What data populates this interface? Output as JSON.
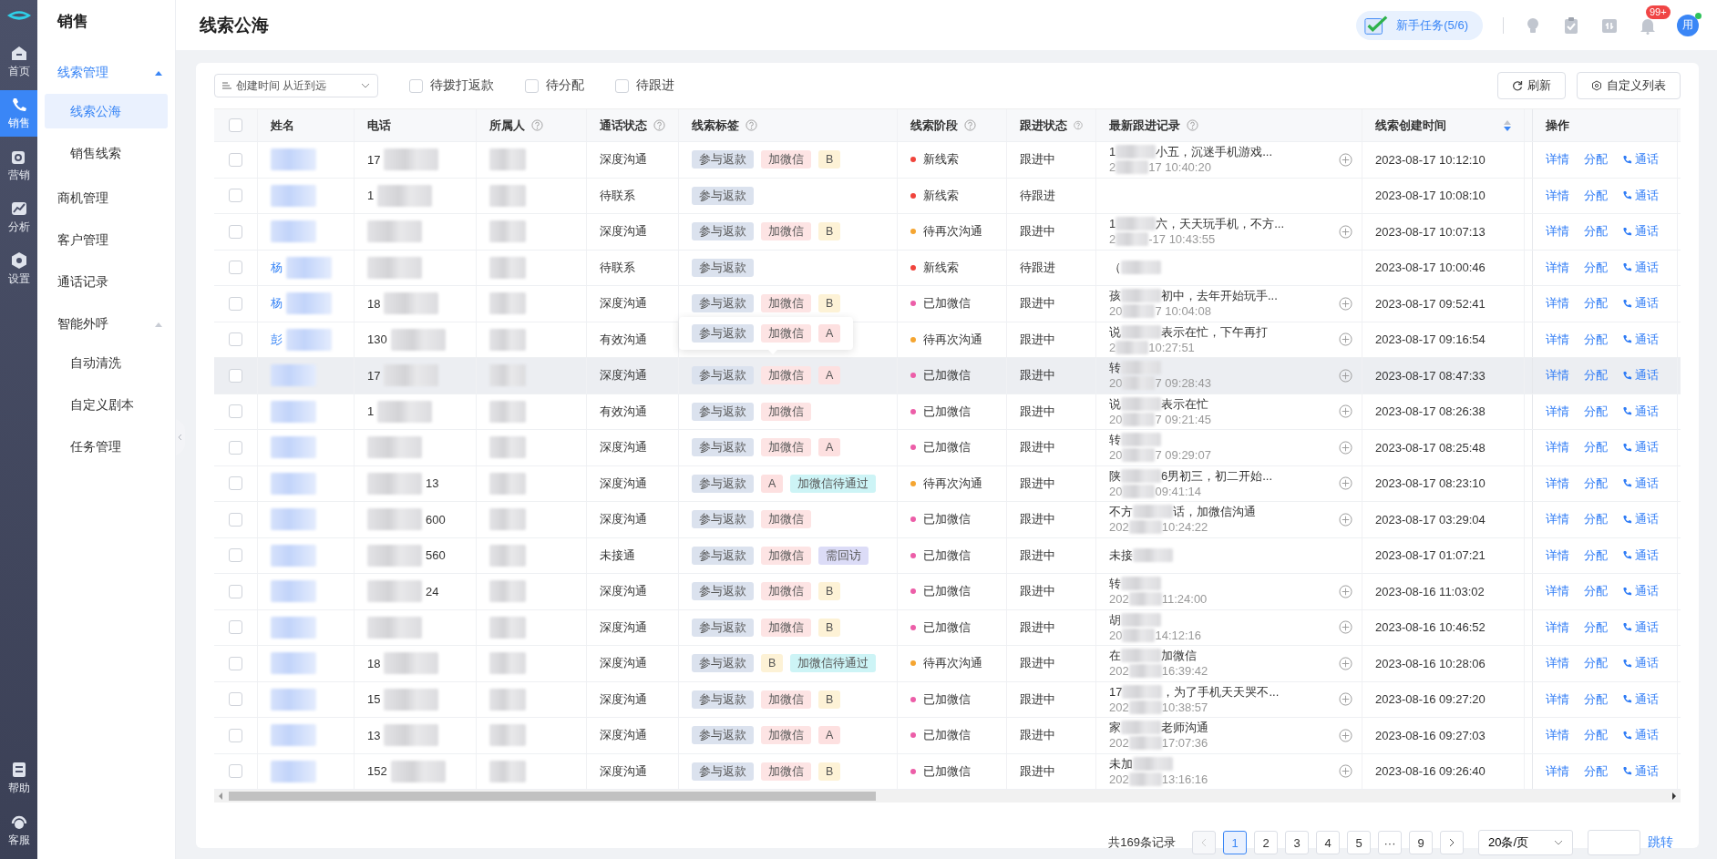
{
  "rail": [
    {
      "label": "首页",
      "selected": false
    },
    {
      "label": "销售",
      "selected": true
    },
    {
      "label": "营销",
      "selected": false
    },
    {
      "label": "分析",
      "selected": false
    },
    {
      "label": "设置",
      "selected": false
    }
  ],
  "rail_bottom": [
    {
      "label": "帮助"
    },
    {
      "label": "客服"
    }
  ],
  "menu": {
    "title": "销售",
    "groups": [
      {
        "label": "线索管理",
        "active": true,
        "expanded": true,
        "children": [
          {
            "label": "线索公海",
            "selected": true
          },
          {
            "label": "销售线索",
            "selected": false
          }
        ]
      },
      {
        "label": "商机管理",
        "active": false
      },
      {
        "label": "客户管理",
        "active": false
      },
      {
        "label": "通话记录",
        "active": false
      },
      {
        "label": "智能外呼",
        "active": false,
        "expanded": true,
        "children": [
          {
            "label": "自动清洗",
            "selected": false
          },
          {
            "label": "自定义剧本",
            "selected": false
          },
          {
            "label": "任务管理",
            "selected": false
          }
        ]
      }
    ]
  },
  "page_title": "线索公海",
  "task_button": "新手任务(5/6)",
  "notification_badge": "99+",
  "avatar": "用",
  "toolbar": {
    "sort": "创建时间 从近到远",
    "filters": [
      {
        "label": "待拨打返款",
        "checked": false
      },
      {
        "label": "待分配",
        "checked": false
      },
      {
        "label": "待跟进",
        "checked": false
      }
    ],
    "buttons": [
      "刷新",
      "自定义列表"
    ]
  },
  "table": {
    "header_checked": false,
    "columns": [
      {
        "label": "姓名",
        "help": false
      },
      {
        "label": "电话",
        "help": false
      },
      {
        "label": "所属人",
        "help": true
      },
      {
        "label": "通话状态",
        "help": true
      },
      {
        "label": "线索标签",
        "help": true
      },
      {
        "label": "线索阶段",
        "help": true
      },
      {
        "label": "跟进状态",
        "help": true
      },
      {
        "label": "最新跟进记录",
        "help": true
      },
      {
        "label": "线索创建时间",
        "help": false,
        "sortable": true
      },
      {
        "label": "操作",
        "help": false
      }
    ],
    "rows": [
      {
        "checked": false,
        "hovered": false,
        "phone": "17",
        "call_status": "深度沟通",
        "tags": [
          {
            "text": "参与返款",
            "color": "#dbe2ee"
          },
          {
            "text": "加微信",
            "color": "#fde4e4"
          },
          {
            "text": "B",
            "color": "#fdf2d6"
          }
        ],
        "stage": {
          "text": "新线索",
          "color": "#f0443c"
        },
        "follow": "跟进中",
        "note": {
          "head": "1",
          "tail": "小五，沉迷手机游戏...",
          "time_head": "2",
          "time_tail": "17 10:40:20"
        },
        "created": "2023-08-17 10:12:10",
        "actions": [
          "详情",
          "分配",
          "通话"
        ]
      },
      {
        "checked": false,
        "hovered": false,
        "phone": "1",
        "call_status": "待联系",
        "tags": [
          {
            "text": "参与返款",
            "color": "#dbe2ee"
          }
        ],
        "stage": {
          "text": "新线索",
          "color": "#f0443c"
        },
        "follow": "待跟进",
        "created": "2023-08-17 10:08:10",
        "actions": [
          "详情",
          "分配",
          "通话"
        ]
      },
      {
        "checked": false,
        "hovered": false,
        "call_status": "深度沟通",
        "tags": [
          {
            "text": "参与返款",
            "color": "#dbe2ee"
          },
          {
            "text": "加微信",
            "color": "#fde4e4"
          },
          {
            "text": "B",
            "color": "#fdf2d6"
          }
        ],
        "stage": {
          "text": "待再次沟通",
          "color": "#f5a531"
        },
        "follow": "跟进中",
        "note": {
          "head": "1",
          "tail": "六，天天玩手机，不方...",
          "time_head": "2",
          "time_tail": "-17 10:43:55"
        },
        "created": "2023-08-17 10:07:13",
        "actions": [
          "详情",
          "分配",
          "通话"
        ]
      },
      {
        "checked": false,
        "hovered": false,
        "name": "杨",
        "call_status": "待联系",
        "tags": [
          {
            "text": "参与返款",
            "color": "#dbe2ee"
          }
        ],
        "stage": {
          "text": "新线索",
          "color": "#f0443c"
        },
        "follow": "待跟进",
        "note": {
          "head": "（"
        },
        "created": "2023-08-17 10:00:46",
        "actions": [
          "详情",
          "分配",
          "通话"
        ]
      },
      {
        "checked": false,
        "hovered": false,
        "name": "杨",
        "phone": "18",
        "call_status": "深度沟通",
        "tags": [
          {
            "text": "参与返款",
            "color": "#dbe2ee"
          },
          {
            "text": "加微信",
            "color": "#fde4e4"
          },
          {
            "text": "B",
            "color": "#fdf2d6"
          }
        ],
        "stage": {
          "text": "已加微信",
          "color": "#ec5ea8"
        },
        "follow": "跟进中",
        "note": {
          "head": "孩",
          "tail": "初中，去年开始玩手...",
          "time_head": "20",
          "time_tail": "7 10:04:08"
        },
        "created": "2023-08-17 09:52:41",
        "actions": [
          "详情",
          "分配",
          "通话"
        ]
      },
      {
        "checked": false,
        "hovered": false,
        "name": "彭",
        "phone": "130",
        "call_status": "有效沟通",
        "popover": [
          {
            "text": "参与返款",
            "color": "#dbe2ee"
          },
          {
            "text": "加微信",
            "color": "#fde4e4"
          },
          {
            "text": "A",
            "color": "#fde0e0"
          }
        ],
        "stage": {
          "text": "待再次沟通",
          "color": "#f5a531"
        },
        "follow": "跟进中",
        "note": {
          "head": "说",
          "tail": "表示在忙，下午再打",
          "time_head": "2",
          "time_tail": "10:27:51"
        },
        "created": "2023-08-17 09:16:54",
        "actions": [
          "详情",
          "分配",
          "通话"
        ]
      },
      {
        "checked": false,
        "hovered": true,
        "phone": "17",
        "call_status": "深度沟通",
        "tags": [
          {
            "text": "参与返款",
            "color": "#dbe2ee"
          },
          {
            "text": "加微信",
            "color": "#fde4e4"
          },
          {
            "text": "A",
            "color": "#fde0e0"
          }
        ],
        "stage": {
          "text": "已加微信",
          "color": "#ec5ea8"
        },
        "follow": "跟进中",
        "note": {
          "head": "转",
          "time_head": "20",
          "time_tail": "7 09:28:43"
        },
        "created": "2023-08-17 08:47:33",
        "actions": [
          "详情",
          "分配",
          "通话"
        ]
      },
      {
        "checked": false,
        "hovered": false,
        "phone": "1",
        "call_status": "有效沟通",
        "tags": [
          {
            "text": "参与返款",
            "color": "#dbe2ee"
          },
          {
            "text": "加微信",
            "color": "#fde4e4"
          }
        ],
        "stage": {
          "text": "已加微信",
          "color": "#ec5ea8"
        },
        "follow": "跟进中",
        "note": {
          "head": "说",
          "tail": "表示在忙",
          "time_head": "20",
          "time_tail": "7 09:21:45"
        },
        "created": "2023-08-17 08:26:38",
        "actions": [
          "详情",
          "分配",
          "通话"
        ]
      },
      {
        "checked": false,
        "hovered": false,
        "call_status": "深度沟通",
        "tags": [
          {
            "text": "参与返款",
            "color": "#dbe2ee"
          },
          {
            "text": "加微信",
            "color": "#fde4e4"
          },
          {
            "text": "A",
            "color": "#fde0e0"
          }
        ],
        "stage": {
          "text": "已加微信",
          "color": "#ec5ea8"
        },
        "follow": "跟进中",
        "note": {
          "head": "转",
          "time_head": "20",
          "time_tail": "7 09:29:07"
        },
        "created": "2023-08-17 08:25:48",
        "actions": [
          "详情",
          "分配",
          "通话"
        ]
      },
      {
        "checked": false,
        "hovered": false,
        "phone_tail": "13",
        "call_status": "深度沟通",
        "tags": [
          {
            "text": "参与返款",
            "color": "#dbe2ee"
          },
          {
            "text": "A",
            "color": "#fde0e0"
          },
          {
            "text": "加微信待通过",
            "color": "#cdf4f6"
          }
        ],
        "stage": {
          "text": "待再次沟通",
          "color": "#f5a531"
        },
        "follow": "跟进中",
        "note": {
          "head": "陕",
          "tail": "6男初三，初二开始...",
          "time_head": "20",
          "time_tail": "09:41:14"
        },
        "created": "2023-08-17 08:23:10",
        "actions": [
          "详情",
          "分配",
          "通话"
        ]
      },
      {
        "checked": false,
        "hovered": false,
        "phone_tail": "600",
        "call_status": "深度沟通",
        "tags": [
          {
            "text": "参与返款",
            "color": "#dbe2ee"
          },
          {
            "text": "加微信",
            "color": "#fde4e4"
          }
        ],
        "stage": {
          "text": "已加微信",
          "color": "#ec5ea8"
        },
        "follow": "跟进中",
        "note": {
          "head": "不方",
          "tail": "话，加微信沟通",
          "time_head": "202",
          "time_tail": "10:24:22"
        },
        "created": "2023-08-17 03:29:04",
        "actions": [
          "详情",
          "分配",
          "通话"
        ]
      },
      {
        "checked": false,
        "hovered": false,
        "phone_tail": "560",
        "call_status": "未接通",
        "tags": [
          {
            "text": "参与返款",
            "color": "#dbe2ee"
          },
          {
            "text": "加微信",
            "color": "#fde4e4"
          },
          {
            "text": "需回访",
            "color": "#dcdcf7"
          }
        ],
        "stage": {
          "text": "已加微信",
          "color": "#ec5ea8"
        },
        "follow": "跟进中",
        "note": {
          "head": "未接"
        },
        "created": "2023-08-17 01:07:21",
        "actions": [
          "详情",
          "分配",
          "通话"
        ]
      },
      {
        "checked": false,
        "hovered": false,
        "phone_tail": "24",
        "call_status": "深度沟通",
        "tags": [
          {
            "text": "参与返款",
            "color": "#dbe2ee"
          },
          {
            "text": "加微信",
            "color": "#fde4e4"
          },
          {
            "text": "B",
            "color": "#fdf2d6"
          }
        ],
        "stage": {
          "text": "已加微信",
          "color": "#ec5ea8"
        },
        "follow": "跟进中",
        "note": {
          "head": "转",
          "time_head": "202",
          "time_tail": "11:24:00"
        },
        "created": "2023-08-16 11:03:02",
        "actions": [
          "详情",
          "分配",
          "通话"
        ]
      },
      {
        "checked": false,
        "hovered": false,
        "call_status": "深度沟通",
        "tags": [
          {
            "text": "参与返款",
            "color": "#dbe2ee"
          },
          {
            "text": "加微信",
            "color": "#fde4e4"
          },
          {
            "text": "B",
            "color": "#fdf2d6"
          }
        ],
        "stage": {
          "text": "已加微信",
          "color": "#ec5ea8"
        },
        "follow": "跟进中",
        "note": {
          "head": "胡",
          "time_head": "20",
          "time_tail": "14:12:16"
        },
        "created": "2023-08-16 10:46:52",
        "actions": [
          "详情",
          "分配",
          "通话"
        ]
      },
      {
        "checked": false,
        "hovered": false,
        "phone": "18",
        "call_status": "深度沟通",
        "tags": [
          {
            "text": "参与返款",
            "color": "#dbe2ee"
          },
          {
            "text": "B",
            "color": "#fdf2d6"
          },
          {
            "text": "加微信待通过",
            "color": "#cdf4f6"
          }
        ],
        "stage": {
          "text": "待再次沟通",
          "color": "#f5a531"
        },
        "follow": "跟进中",
        "note": {
          "head": "在",
          "tail": "加微信",
          "time_head": "202",
          "time_tail": "16:39:42"
        },
        "created": "2023-08-16 10:28:06",
        "actions": [
          "详情",
          "分配",
          "通话"
        ]
      },
      {
        "checked": false,
        "hovered": false,
        "phone": "15",
        "call_status": "深度沟通",
        "tags": [
          {
            "text": "参与返款",
            "color": "#dbe2ee"
          },
          {
            "text": "加微信",
            "color": "#fde4e4"
          },
          {
            "text": "B",
            "color": "#fdf2d6"
          }
        ],
        "stage": {
          "text": "已加微信",
          "color": "#ec5ea8"
        },
        "follow": "跟进中",
        "note": {
          "head": "17",
          "tail": "，为了手机天天哭不...",
          "time_head": "202",
          "time_tail": "10:38:57"
        },
        "created": "2023-08-16 09:27:20",
        "actions": [
          "详情",
          "分配",
          "通话"
        ]
      },
      {
        "checked": false,
        "hovered": false,
        "phone": "13",
        "call_status": "深度沟通",
        "tags": [
          {
            "text": "参与返款",
            "color": "#dbe2ee"
          },
          {
            "text": "加微信",
            "color": "#fde4e4"
          },
          {
            "text": "A",
            "color": "#fde0e0"
          }
        ],
        "stage": {
          "text": "已加微信",
          "color": "#ec5ea8"
        },
        "follow": "跟进中",
        "note": {
          "head": "家",
          "tail": "老师沟通",
          "time_head": "202",
          "time_tail": "17:07:36"
        },
        "created": "2023-08-16 09:27:03",
        "actions": [
          "详情",
          "分配",
          "通话"
        ]
      },
      {
        "checked": false,
        "hovered": false,
        "phone": "152",
        "call_status": "深度沟通",
        "tags": [
          {
            "text": "参与返款",
            "color": "#dbe2ee"
          },
          {
            "text": "加微信",
            "color": "#fde4e4"
          },
          {
            "text": "B",
            "color": "#fdf2d6"
          }
        ],
        "stage": {
          "text": "已加微信",
          "color": "#ec5ea8"
        },
        "follow": "跟进中",
        "note": {
          "head": "未加",
          "time_head": "202",
          "time_tail": "13:16:16"
        },
        "created": "2023-08-16 09:26:40",
        "actions": [
          "详情",
          "分配",
          "通话"
        ]
      }
    ]
  },
  "pagination": {
    "total": "共169条记录",
    "pages": [
      {
        "label": "1",
        "selected": true
      },
      {
        "label": "2",
        "selected": false
      },
      {
        "label": "3",
        "selected": false
      },
      {
        "label": "4",
        "selected": false
      },
      {
        "label": "5",
        "selected": false
      },
      {
        "label": "···",
        "selected": false
      },
      {
        "label": "9",
        "selected": false
      }
    ],
    "page_size": "20条/页",
    "jump": "跳转"
  }
}
